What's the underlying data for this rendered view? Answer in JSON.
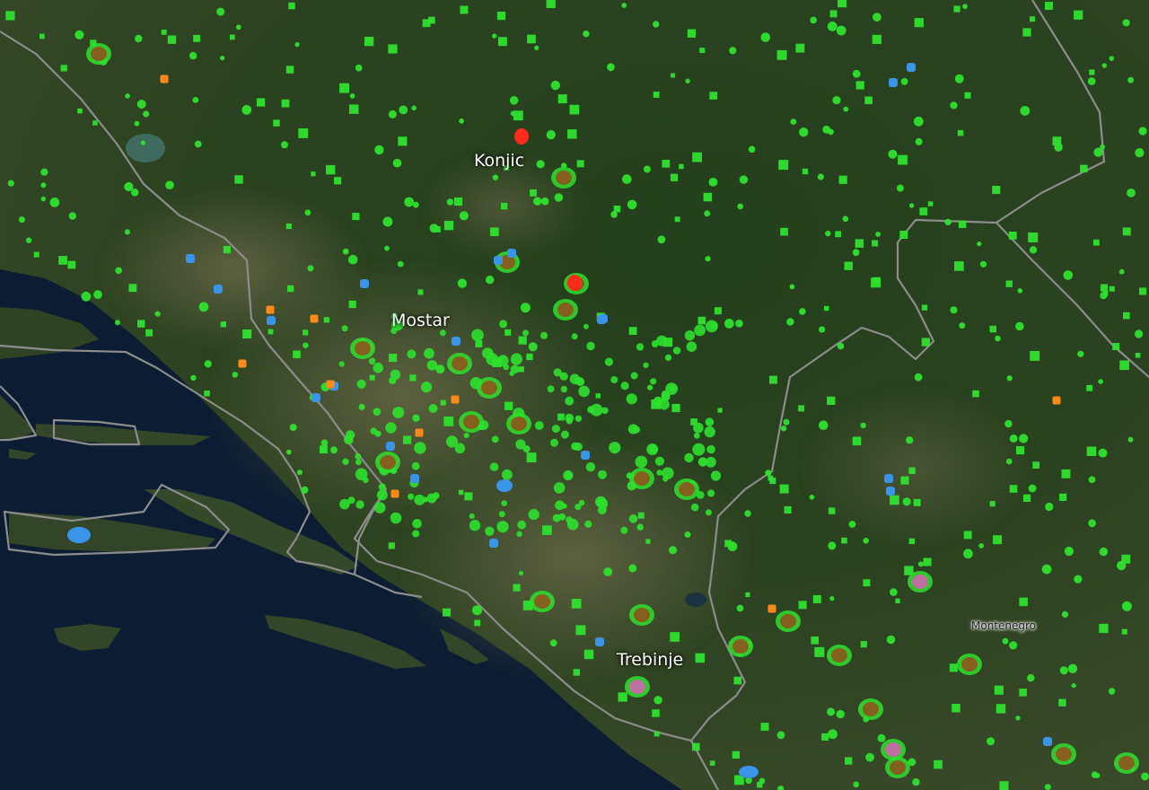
{
  "map": {
    "city_labels": [
      "Konjic",
      "Mostar",
      "Trebinje"
    ],
    "country_labels": [
      "Montenegro"
    ],
    "colors": {
      "sea": "#0c1d33",
      "sea_deep": "#0a1628",
      "land_dark": "#1d3418",
      "land_mid": "#2f4623",
      "land_dry": "#5a5a3f",
      "karst": "#7a7560",
      "border": "#8c8c8c",
      "marker_green": "#2ee02e",
      "marker_blue": "#3a95e8",
      "marker_orange": "#ff8a1a",
      "marker_red": "#ff2a1a",
      "hotspot_brown": "#8a5a1c",
      "hotspot_pink": "#c86aa8"
    }
  }
}
